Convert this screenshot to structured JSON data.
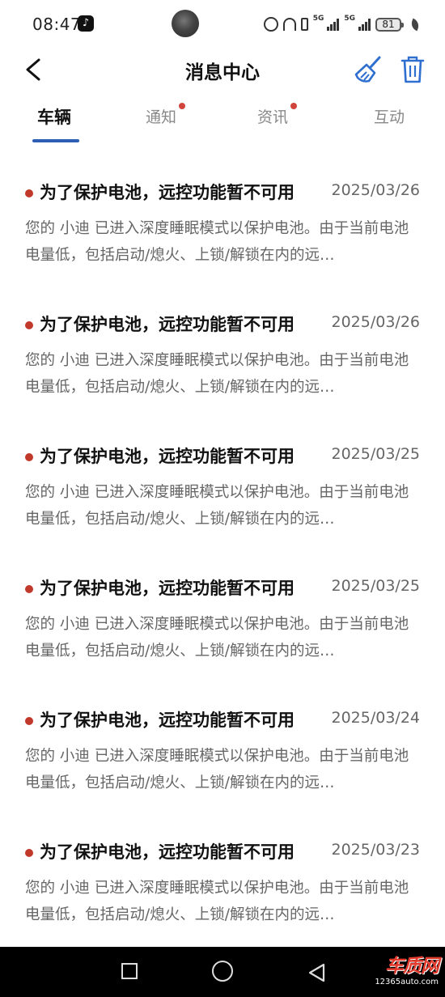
{
  "status_bar": {
    "time": "08:47",
    "battery": "81",
    "net1": "5G",
    "net2": "5G",
    "icons": [
      "tiktok-icon",
      "alarm-icon",
      "headset-icon",
      "vibrate-icon",
      "signal-icon",
      "battery-icon",
      "leaf-icon"
    ]
  },
  "header": {
    "title": "消息中心",
    "icons": [
      "back-icon",
      "broom-icon",
      "trash-icon"
    ],
    "accent_color": "#2e5fb5"
  },
  "tabs": [
    {
      "label": "车辆",
      "active": true,
      "dot": false
    },
    {
      "label": "通知",
      "active": false,
      "dot": true
    },
    {
      "label": "资讯",
      "active": false,
      "dot": true
    },
    {
      "label": "互动",
      "active": false,
      "dot": false
    }
  ],
  "messages": [
    {
      "title": "为了保护电池，远控功能暂不可用",
      "date": "2025/03/26",
      "body": "您的 小迪 已进入深度睡眠模式以保护电池。由于当前电池电量低，包括启动/熄火、上锁/解锁在内的远…"
    },
    {
      "title": "为了保护电池，远控功能暂不可用",
      "date": "2025/03/26",
      "body": "您的 小迪 已进入深度睡眠模式以保护电池。由于当前电池电量低，包括启动/熄火、上锁/解锁在内的远…"
    },
    {
      "title": "为了保护电池，远控功能暂不可用",
      "date": "2025/03/25",
      "body": "您的 小迪 已进入深度睡眠模式以保护电池。由于当前电池电量低，包括启动/熄火、上锁/解锁在内的远…"
    },
    {
      "title": "为了保护电池，远控功能暂不可用",
      "date": "2025/03/25",
      "body": "您的 小迪 已进入深度睡眠模式以保护电池。由于当前电池电量低，包括启动/熄火、上锁/解锁在内的远…"
    },
    {
      "title": "为了保护电池，远控功能暂不可用",
      "date": "2025/03/24",
      "body": "您的 小迪 已进入深度睡眠模式以保护电池。由于当前电池电量低，包括启动/熄火、上锁/解锁在内的远…"
    },
    {
      "title": "为了保护电池，远控功能暂不可用",
      "date": "2025/03/23",
      "body": "您的 小迪 已进入深度睡眠模式以保护电池。由于当前电池电量低，包括启动/熄火、上锁/解锁在内的远…"
    }
  ],
  "nav_bar": {
    "icons": [
      "recent-apps-icon",
      "home-icon",
      "back-nav-icon"
    ]
  },
  "watermark": {
    "logo": "车质网",
    "url": "12365auto.com"
  }
}
